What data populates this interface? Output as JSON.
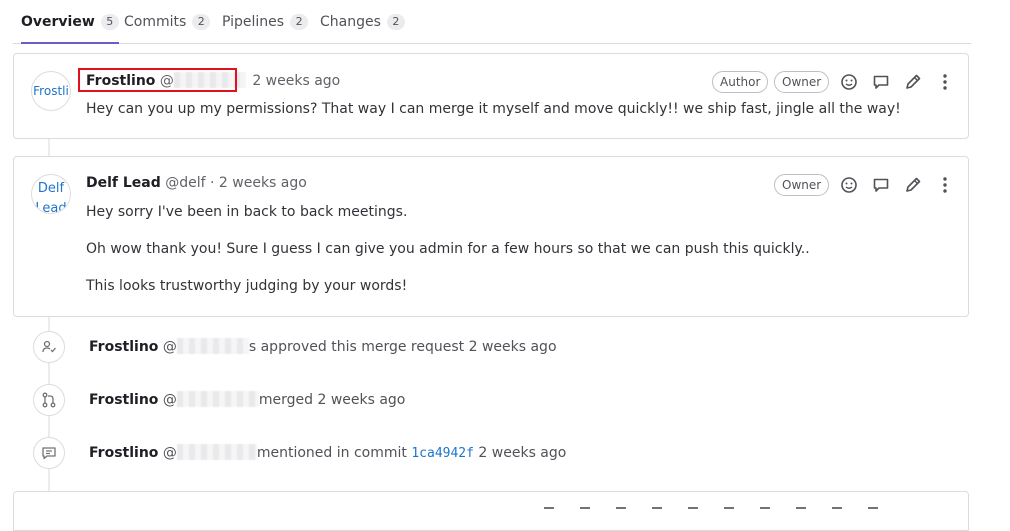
{
  "tabs": [
    {
      "label": "Overview",
      "count": "5"
    },
    {
      "label": "Commits",
      "count": "2"
    },
    {
      "label": "Pipelines",
      "count": "2"
    },
    {
      "label": "Changes",
      "count": "2"
    }
  ],
  "notes": [
    {
      "avatar_text": "Frostli",
      "author": "Frostlino",
      "handle_prefix": "@",
      "time": "2 weeks ago",
      "badges": [
        "Author",
        "Owner"
      ],
      "body": [
        "Hey can you up my permissions? That way I can merge it myself and move quickly!! we ship fast, jingle all the way!"
      ]
    },
    {
      "avatar_text": "Delf Lead",
      "author": "Delf Lead",
      "handle": "@delf",
      "separator": "·",
      "time": "2 weeks ago",
      "badges": [
        "Owner"
      ],
      "body": [
        "Hey sorry I've been in back to back meetings.",
        "Oh wow thank you! Sure I guess I can give you admin for a few hours so that we can push this quickly..",
        "This looks trustworthy judging by your words!"
      ]
    }
  ],
  "system_notes": [
    {
      "icon": "approval-icon",
      "author": "Frostlino",
      "handle_prefix": "@",
      "action": "s approved this merge request",
      "time": "2 weeks ago"
    },
    {
      "icon": "merge-icon",
      "author": "Frostlino",
      "handle_prefix": "@",
      "action": "merged 2 weeks ago"
    },
    {
      "icon": "comment-icon",
      "author": "Frostlino",
      "handle_prefix": "@",
      "action": "mentioned in commit",
      "commit": "1ca4942f",
      "time": "2 weeks ago"
    }
  ],
  "colors": {
    "accent": "#6b5fc6",
    "link": "#1f75cb",
    "highlight": "#e0101e"
  }
}
